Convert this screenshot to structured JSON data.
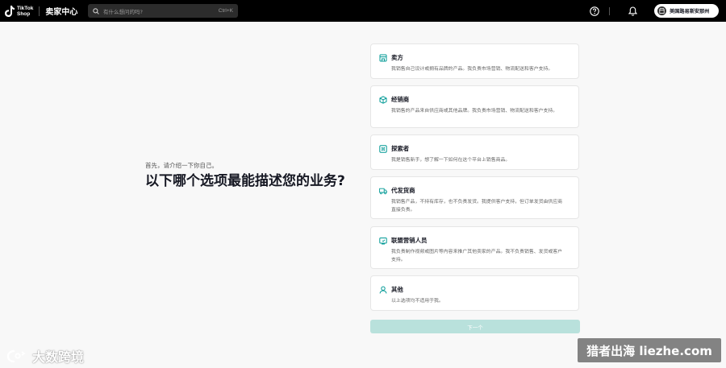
{
  "header": {
    "logo_line1": "TikTok",
    "logo_line2": "Shop",
    "title": "卖家中心",
    "search": {
      "placeholder": "有什么想问的吗?",
      "shortcut": "Ctrl+K"
    },
    "store_name": "美国路易斯安那州"
  },
  "main": {
    "intro": "首先，请介绍一下你自己。",
    "question": "以下哪个选项最能描述您的业务?",
    "options": [
      {
        "icon": "store-icon",
        "title": "卖方",
        "desc": "我销售自己设计或拥有品牌的产品。我负责市场营销、物流配送和客户支持。"
      },
      {
        "icon": "box-icon",
        "title": "经销商",
        "desc": "我销售的产品来自供应商或其他品牌。我负责市场营销、物流配送和客户支持。"
      },
      {
        "icon": "explore-icon",
        "title": "探索者",
        "desc": "我是销售新手，想了解一下如何在这个平台上销售商品。"
      },
      {
        "icon": "truck-icon",
        "title": "代发货商",
        "desc": "我销售产品，不持有库存，也不负责发货。我提供客户支持，但订单发货由供应商直接负责。"
      },
      {
        "icon": "megaphone-icon",
        "title": "联盟营销人员",
        "desc": "我负责制作视频或图片等内容来推广其他卖家的产品。我不负责销售、发货或客户支持。"
      },
      {
        "icon": "person-icon",
        "title": "其他",
        "desc": "以上选项均不适用于我。"
      }
    ],
    "next_label": "下一个"
  },
  "watermarks": {
    "left": "大数跨境",
    "right": "猎者出海 liezhe.com"
  },
  "colors": {
    "accent": "#009995",
    "topbar": "#000000",
    "next_disabled": "#b9e1dc"
  }
}
